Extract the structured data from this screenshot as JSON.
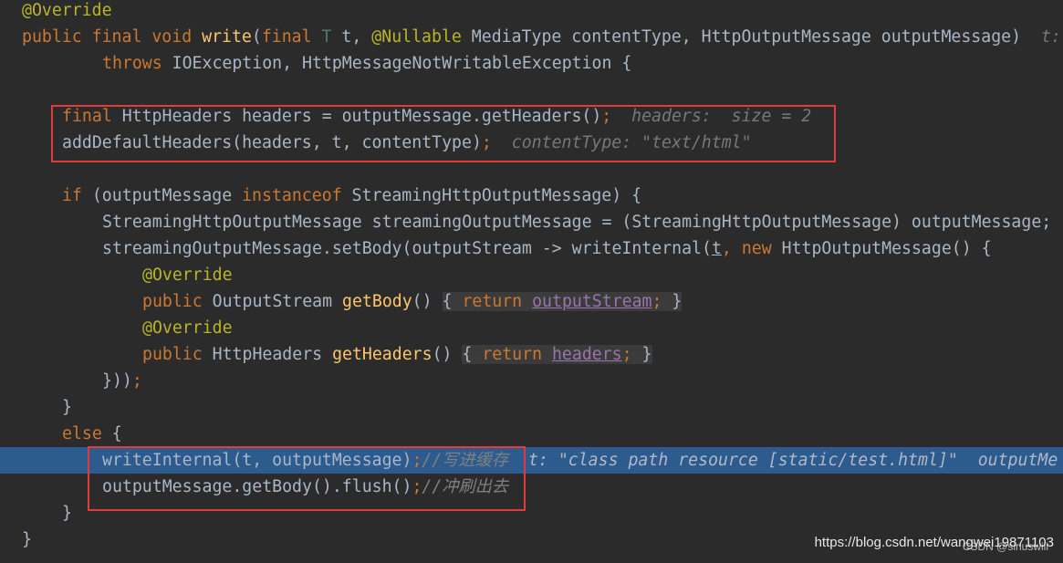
{
  "code": {
    "l1_ann": "@Override",
    "l2_public": "public",
    "l2_final": "final",
    "l2_void": "void",
    "l2_fn": "write",
    "l2_final2": "final",
    "l2_T": "T",
    "l2_t": " t",
    "l2_nullable": "@Nullable",
    "l2_rest": " MediaType contentType, HttpOutputMessage outputMessage)",
    "l2_hint": "t:",
    "l3_throws": "throws",
    "l3_rest": " IOException, HttpMessageNotWritableException {",
    "l5_final": "final",
    "l5_code": " HttpHeaders headers = outputMessage.getHeaders()",
    "l5_hint": "headers:  size = 2",
    "l6_code": "addDefaultHeaders(headers, t, contentType)",
    "l6_hint": "contentType: \"text/html\"",
    "l8_if": "if",
    "l8_mid": " (outputMessage ",
    "l8_instanceof": "instanceof",
    "l8_rest": " StreamingHttpOutputMessage) {",
    "l9_code": "StreamingHttpOutputMessage streamingOutputMessage = (StreamingHttpOutputMessage) outputMessage;",
    "l10_a": "streamingOutputMessage.setBody(outputStream -> writeInternal(",
    "l10_t": "t",
    "l10_new": "new",
    "l10_rest": " HttpOutputMessage() {",
    "l11_ann": "@Override",
    "l12_public": "public",
    "l12_type": " OutputStream ",
    "l12_fn": "getBody",
    "l12_return": "return",
    "l12_field": "outputStream",
    "l13_ann": "@Override",
    "l14_public": "public",
    "l14_type": " HttpHeaders ",
    "l14_fn": "getHeaders",
    "l14_return": "return",
    "l14_field": "headers",
    "l15_code": "}))",
    "l16_code": "}",
    "l17_else": "else",
    "l17_rest": " {",
    "l18_code": "writeInternal(t, outputMessage)",
    "l18_cmt": "//写进缓存",
    "l18_hint": "t: \"class path resource [static/test.html]\"  outputMe",
    "l19_code": "outputMessage.getBody().flush()",
    "l19_cmt": "//冲刷出去",
    "l20_code": "}",
    "l21_code": "}"
  },
  "watermark": {
    "url": "https://blog.csdn.net/wangwei19871103",
    "site": "CSDN @siriuswill"
  },
  "colors": {
    "background": "#2b2b2b",
    "highlight_line": "#2d5b8e",
    "keyword": "#cc7832",
    "annotation": "#bbb529",
    "method": "#ffc66d",
    "field": "#9876aa",
    "default_text": "#a9b7c6",
    "red_box": "#e03c3c"
  }
}
